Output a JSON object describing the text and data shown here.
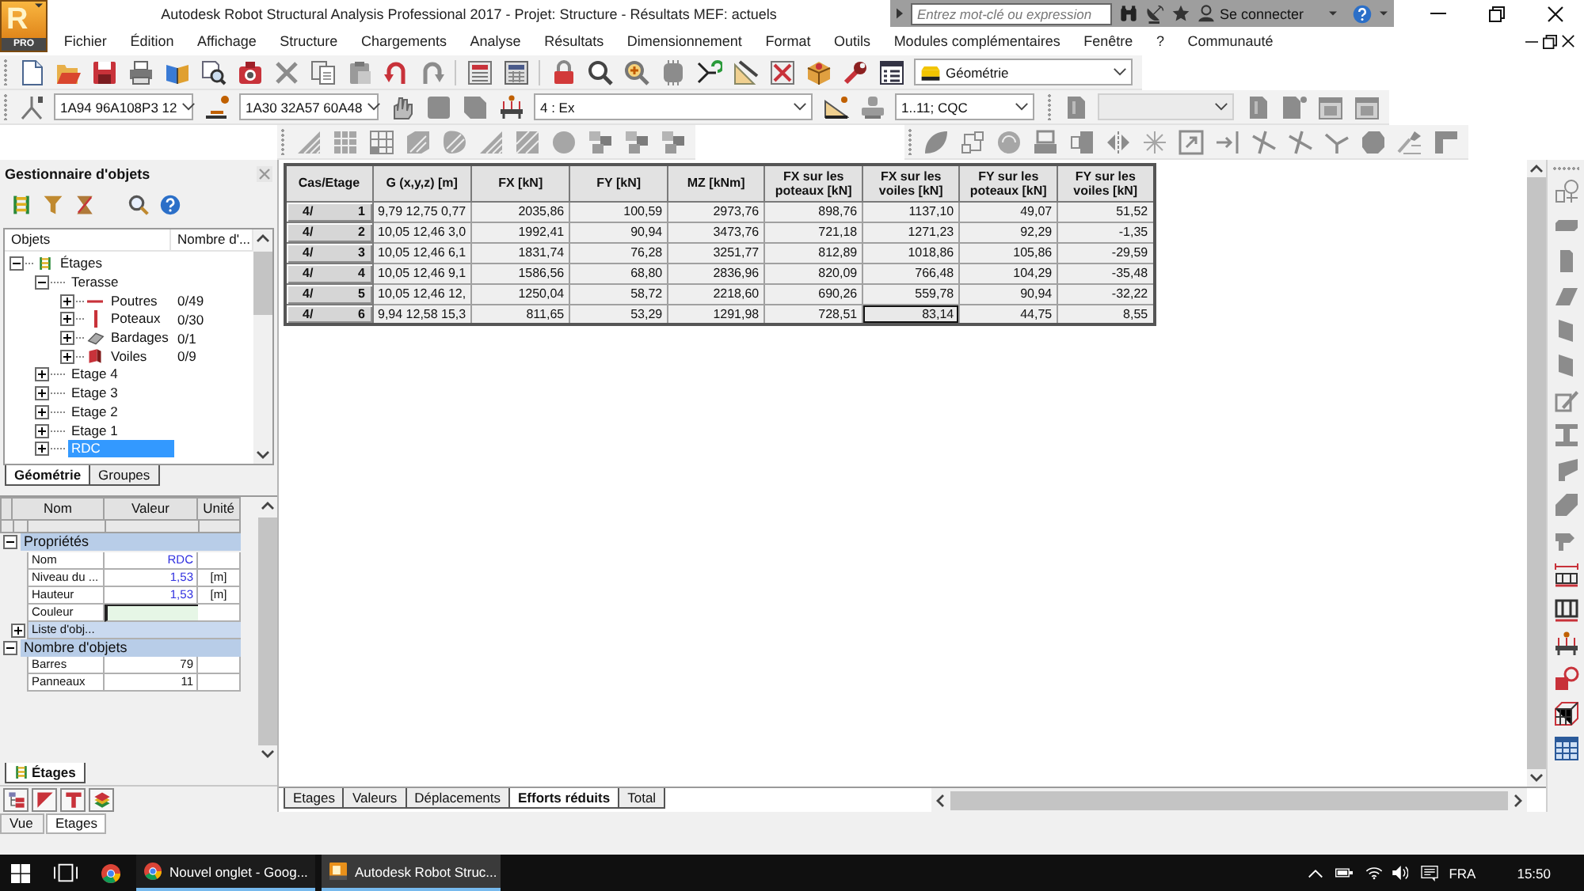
{
  "window": {
    "app_button": {
      "letter": "R",
      "badge": "PRO"
    },
    "title": "Autodesk Robot Structural Analysis Professional 2017 - Projet: Structure - Résultats MEF: actuels",
    "search": {
      "placeholder": "Entrez mot-clé ou expression"
    },
    "sign_in": "Se connecter"
  },
  "menu": [
    "Fichier",
    "Édition",
    "Affichage",
    "Structure",
    "Chargements",
    "Analyse",
    "Résultats",
    "Dimensionnement",
    "Format",
    "Outils",
    "Modules complémentaires",
    "Fenêtre",
    "?",
    "Communauté"
  ],
  "toolbars": {
    "view_selector": "Géométrie",
    "section_selector": "1A94 96A108P3 12",
    "section_selector_2": "1A30 32A57 60A48",
    "load_case_selector": "4 : Ex",
    "combination_selector": "1..11; CQC",
    "inactive_selector": {
      "disabled": true
    }
  },
  "object_manager": {
    "title": "Gestionnaire d'objets",
    "tree_columns": [
      "Objets",
      "Nombre d'..."
    ],
    "tree": [
      {
        "label": "Étages",
        "kind": "storey-set",
        "expanded": true,
        "selected": false,
        "children": [
          {
            "label": "Terasse",
            "kind": "storey",
            "expanded": true,
            "selected": false,
            "children": [
              {
                "label": "Poutres",
                "kind": "beam",
                "count": "0/49",
                "expanded": false,
                "selected": false
              },
              {
                "label": "Poteaux",
                "kind": "column",
                "count": "0/30",
                "expanded": false,
                "selected": false
              },
              {
                "label": "Bardages",
                "kind": "cladding",
                "count": "0/1",
                "expanded": false,
                "selected": false
              },
              {
                "label": "Voiles",
                "kind": "wall",
                "count": "0/9",
                "expanded": false,
                "selected": false
              }
            ]
          },
          {
            "label": "Etage 4",
            "kind": "storey",
            "expanded": false,
            "selected": false
          },
          {
            "label": "Etage 3",
            "kind": "storey",
            "expanded": false,
            "selected": false
          },
          {
            "label": "Etage 2",
            "kind": "storey",
            "expanded": false,
            "selected": false
          },
          {
            "label": "Etage 1",
            "kind": "storey",
            "expanded": false,
            "selected": false
          },
          {
            "label": "RDC",
            "kind": "storey",
            "expanded": false,
            "selected": true
          }
        ]
      }
    ],
    "tabs": [
      {
        "label": "Géométrie",
        "selected": true
      },
      {
        "label": "Groupes",
        "selected": false
      }
    ]
  },
  "properties": {
    "columns": [
      "Nom",
      "Valeur",
      "Unité"
    ],
    "groups": [
      {
        "title": "Propriétés",
        "expanded": true,
        "rows": [
          {
            "name": "Nom",
            "kind": "value",
            "value": "RDC",
            "editable": true
          },
          {
            "name": "Niveau du ...",
            "kind": "value",
            "value": "1,53",
            "unit": "[m]",
            "editable": true
          },
          {
            "name": "Hauteur",
            "kind": "value",
            "value": "1,53",
            "unit": "[m]",
            "editable": true
          },
          {
            "name": "Couleur",
            "kind": "color",
            "color": "#e6f6e6"
          },
          {
            "name": "Liste d'obj...",
            "kind": "group",
            "expanded": false
          }
        ]
      },
      {
        "title": "Nombre d'objets",
        "expanded": true,
        "rows": [
          {
            "name": "Barres",
            "kind": "value",
            "value": "79",
            "editable": false
          },
          {
            "name": "Panneaux",
            "kind": "value",
            "value": "11",
            "editable": false
          }
        ]
      }
    ]
  },
  "inspector_tabs": [
    {
      "label": "Étages",
      "selected": true
    }
  ],
  "results_table": {
    "corner": "Cas/Etage",
    "columns": [
      "G (x,y,z) [m]",
      "FX [kN]",
      "FY [kN]",
      "MZ [kNm]",
      "FX sur les poteaux [kN]",
      "FX sur les voiles [kN]",
      "FY sur les poteaux [kN]",
      "FY sur les voiles [kN]"
    ],
    "rows": [
      {
        "case": "4/",
        "storey": "1",
        "cells": [
          {
            "text": "9,79 12,75 0,77",
            "selected": false
          },
          {
            "text": "2035,86",
            "selected": false
          },
          {
            "text": "100,59",
            "selected": false
          },
          {
            "text": "2973,76",
            "selected": false
          },
          {
            "text": "898,76",
            "selected": false
          },
          {
            "text": "1137,10",
            "selected": false
          },
          {
            "text": "49,07",
            "selected": false
          },
          {
            "text": "51,52",
            "selected": false
          }
        ]
      },
      {
        "case": "4/",
        "storey": "2",
        "cells": [
          {
            "text": "10,05 12,46 3,0",
            "selected": false
          },
          {
            "text": "1992,41",
            "selected": false
          },
          {
            "text": "90,94",
            "selected": false
          },
          {
            "text": "3473,76",
            "selected": false
          },
          {
            "text": "721,18",
            "selected": false
          },
          {
            "text": "1271,23",
            "selected": false
          },
          {
            "text": "92,29",
            "selected": false
          },
          {
            "text": "-1,35",
            "selected": false
          }
        ]
      },
      {
        "case": "4/",
        "storey": "3",
        "cells": [
          {
            "text": "10,05 12,46 6,1",
            "selected": false
          },
          {
            "text": "1831,74",
            "selected": false
          },
          {
            "text": "76,28",
            "selected": false
          },
          {
            "text": "3251,77",
            "selected": false
          },
          {
            "text": "812,89",
            "selected": false
          },
          {
            "text": "1018,86",
            "selected": false
          },
          {
            "text": "105,86",
            "selected": false
          },
          {
            "text": "-29,59",
            "selected": false
          }
        ]
      },
      {
        "case": "4/",
        "storey": "4",
        "cells": [
          {
            "text": "10,05 12,46 9,1",
            "selected": false
          },
          {
            "text": "1586,56",
            "selected": false
          },
          {
            "text": "68,80",
            "selected": false
          },
          {
            "text": "2836,96",
            "selected": false
          },
          {
            "text": "820,09",
            "selected": false
          },
          {
            "text": "766,48",
            "selected": false
          },
          {
            "text": "104,29",
            "selected": false
          },
          {
            "text": "-35,48",
            "selected": false
          }
        ]
      },
      {
        "case": "4/",
        "storey": "5",
        "cells": [
          {
            "text": "10,05 12,46 12,",
            "selected": false
          },
          {
            "text": "1250,04",
            "selected": false
          },
          {
            "text": "58,72",
            "selected": false
          },
          {
            "text": "2218,60",
            "selected": false
          },
          {
            "text": "690,26",
            "selected": false
          },
          {
            "text": "559,78",
            "selected": false
          },
          {
            "text": "90,94",
            "selected": false
          },
          {
            "text": "-32,22",
            "selected": false
          }
        ]
      },
      {
        "case": "4/",
        "storey": "6",
        "cells": [
          {
            "text": "9,94 12,58 15,3",
            "selected": false
          },
          {
            "text": "811,65",
            "selected": false
          },
          {
            "text": "53,29",
            "selected": false
          },
          {
            "text": "1291,98",
            "selected": false
          },
          {
            "text": "728,51",
            "selected": false
          },
          {
            "text": "83,14",
            "selected": true
          },
          {
            "text": "44,75",
            "selected": false
          },
          {
            "text": "8,55",
            "selected": false
          }
        ]
      }
    ]
  },
  "sheet_tabs": [
    {
      "label": "Etages",
      "selected": false
    },
    {
      "label": "Valeurs",
      "selected": false
    },
    {
      "label": "Déplacements",
      "selected": false
    },
    {
      "label": "Efforts réduits",
      "selected": true
    },
    {
      "label": "Total",
      "selected": false
    }
  ],
  "status_bar": [
    "Vue",
    "Etages"
  ],
  "taskbar": {
    "apps": [
      {
        "label": "Nouvel onglet - Goog...",
        "kind": "browser",
        "active": false
      },
      {
        "label": "Autodesk Robot Struc...",
        "kind": "robot",
        "active": true
      }
    ],
    "language": "FRA",
    "time": "15:50"
  }
}
